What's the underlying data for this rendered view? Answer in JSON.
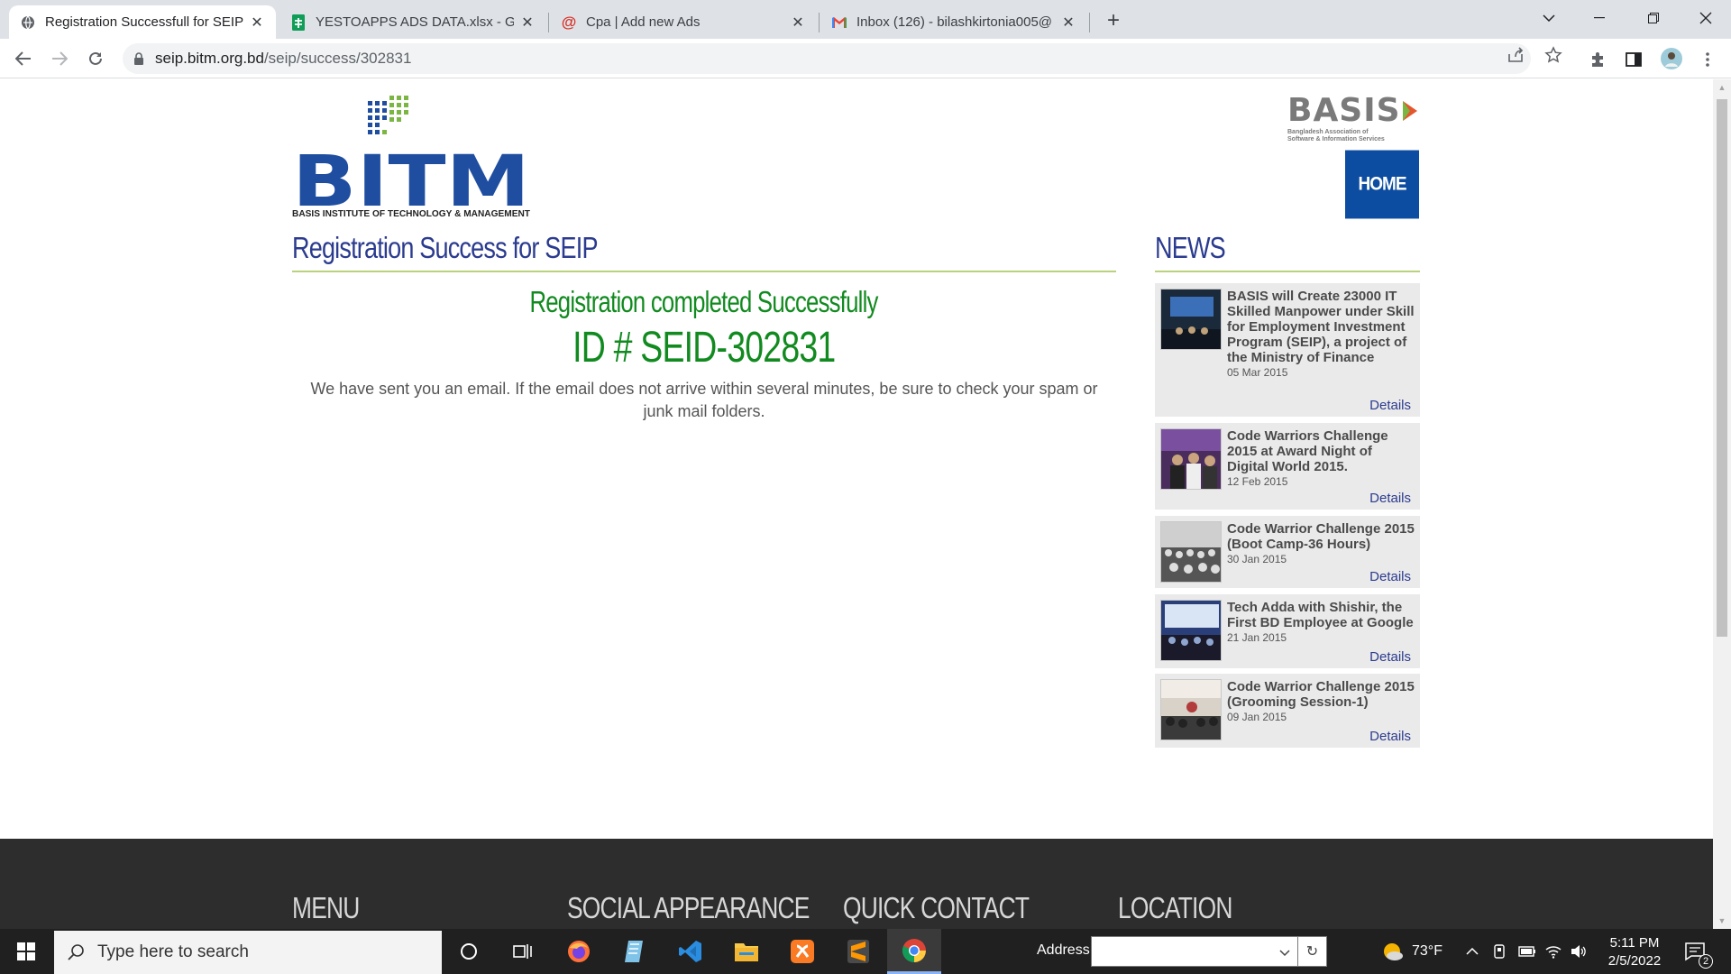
{
  "browser": {
    "tabs": [
      {
        "title": "Registration Successfull for SEIP|",
        "icon": "globe-icon",
        "active": true
      },
      {
        "title": "YESTOAPPS ADS DATA.xlsx - Goo",
        "icon": "google-sheets-icon",
        "active": false
      },
      {
        "title": "Cpa | Add new Ads",
        "icon": "at-sign-icon",
        "active": false
      },
      {
        "title": "Inbox (126) - bilashkirtonia005@",
        "icon": "gmail-icon",
        "active": false
      }
    ],
    "url_host": "seip.bitm.org.bd",
    "url_path": "/seip/success/302831"
  },
  "site": {
    "logo_text": "BITM",
    "logo_subtitle": "BASIS INSTITUTE OF TECHNOLOGY & MANAGEMENT",
    "partner_logo": "BASIS",
    "partner_sub": "Bangladesh Association of Software & Information Services",
    "home_label": "HOME"
  },
  "main": {
    "title": "Registration Success for SEIP",
    "success_heading": "Registration completed Successfully",
    "registration_id": "ID # SEID-302831",
    "message": "We have sent you an email. If the email does not arrive within several minutes, be sure to check your spam or junk mail folders."
  },
  "news": {
    "title": "NEWS",
    "items": [
      {
        "headline": "BASIS will Create 23000 IT Skilled Manpower under Skill for Employment Investment Program (SEIP), a project of the Ministry of Finance",
        "date": "05 Mar 2015",
        "link": "Details"
      },
      {
        "headline": "Code Warriors Challenge 2015 at Award Night of Digital World 2015.",
        "date": "12 Feb 2015",
        "link": "Details"
      },
      {
        "headline": "Code Warrior Challenge 2015 (Boot Camp-36 Hours)",
        "date": "30 Jan 2015",
        "link": "Details"
      },
      {
        "headline": "Tech Adda with Shishir, the First BD Employee at Google",
        "date": "21 Jan 2015",
        "link": "Details"
      },
      {
        "headline": "Code Warrior Challenge 2015 (Grooming Session-1)",
        "date": "09 Jan 2015",
        "link": "Details"
      }
    ]
  },
  "footer": {
    "menu": "MENU",
    "social": "SOCIAL APPEARANCE",
    "contact": "QUICK CONTACT",
    "location": "LOCATION"
  },
  "taskbar": {
    "search_placeholder": "Type here to search",
    "address_label": "Address",
    "temperature": "73°F",
    "time": "5:11 PM",
    "date": "2/5/2022",
    "notification_count": "2"
  },
  "colors": {
    "brand_blue": "#0d4da1",
    "title_blue": "#2b3b8f",
    "success_green": "#118a1f",
    "rule_green": "#b9d27c"
  }
}
